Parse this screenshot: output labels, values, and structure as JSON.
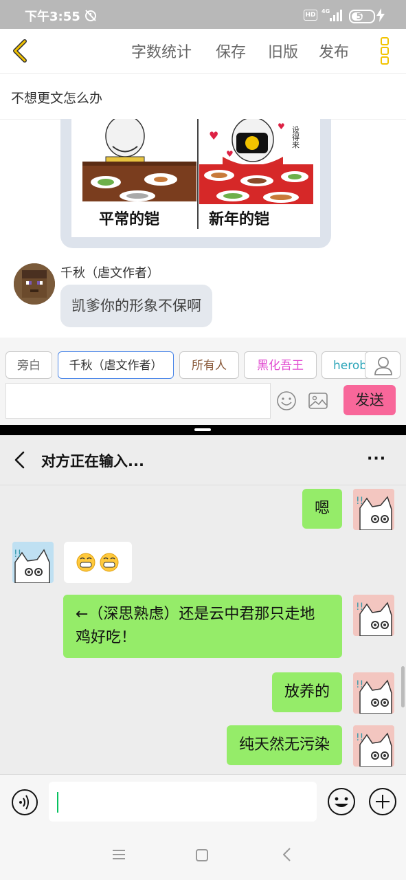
{
  "status_bar": {
    "time": "下午3:55",
    "hd_label": "HD",
    "network": "4G",
    "battery_level": "54",
    "battery_fraction": 0.54
  },
  "editor": {
    "toolbar": {
      "word_count": "字数统计",
      "save": "保存",
      "old_version": "旧版",
      "publish": "发布"
    },
    "doc_title": "不想更文怎么办",
    "meme": {
      "left_caption": "平常的铠",
      "right_caption": "新年的铠",
      "vertical_text": "设得来"
    },
    "message": {
      "author": "千秋（虐文作者）",
      "text": "凯爹你的形象不保啊"
    },
    "roles": [
      "旁白",
      "千秋（虐文作者）",
      "所有人",
      "黑化吾王",
      "herob"
    ],
    "send": "发送",
    "accent_color": "#f8679a"
  },
  "wechat": {
    "title": "对方正在输入...",
    "more": "···",
    "messages": [
      {
        "side": "right",
        "text": "嗯"
      },
      {
        "side": "left",
        "text": "😁😁"
      },
      {
        "side": "right",
        "text": "←（深思熟虑）还是云中君那只走地鸡好吃！"
      },
      {
        "side": "right",
        "text": "放养的"
      },
      {
        "side": "right",
        "text": "纯天然无污染"
      }
    ],
    "bubble_color": "#95ec69"
  },
  "icons": [
    "back-icon",
    "more-icon",
    "person-icon",
    "smiley-icon",
    "image-icon",
    "voice-icon",
    "plus-icon",
    "menu-icon",
    "home-icon",
    "nav-back-icon"
  ]
}
